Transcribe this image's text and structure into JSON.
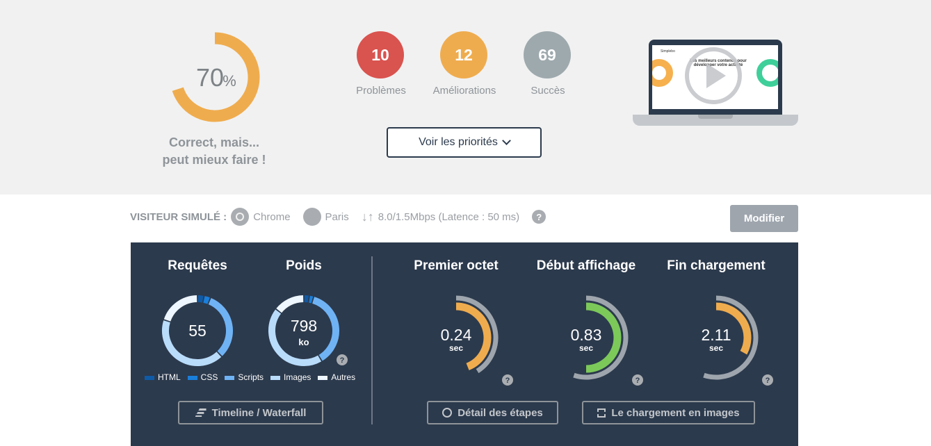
{
  "score": {
    "value": "70",
    "unit": "%",
    "fraction": 0.7,
    "color": "#efac4e",
    "label_line1": "Correct, mais...",
    "label_line2": "peut mieux faire !"
  },
  "counters": [
    {
      "value": "10",
      "label": "Problèmes",
      "color": "#d9534f"
    },
    {
      "value": "12",
      "label": "Améliorations",
      "color": "#efac4e"
    },
    {
      "value": "69",
      "label": "Succès",
      "color": "#9ea9ad"
    }
  ],
  "priorities_button": "Voir les priorités",
  "video": {
    "icon": "play-icon",
    "preview_heading": "Les meilleurs contenus pour développer votre activité",
    "preview_logo": "Simplebo"
  },
  "visitor": {
    "label": "VISITEUR SIMULÉ :",
    "browser": "Chrome",
    "location": "Paris",
    "connection": "8.0/1.5Mbps (Latence : 50 ms)",
    "help": "?",
    "modify_button": "Modifier"
  },
  "requests": {
    "title": "Requêtes",
    "value": "55",
    "segments": [
      0.03,
      0.03,
      0.32,
      0.42,
      0.2
    ]
  },
  "weight": {
    "title": "Poids",
    "value": "798",
    "unit": "ko",
    "help": "?",
    "segments": [
      0.025,
      0.02,
      0.37,
      0.44,
      0.145
    ]
  },
  "legend": [
    {
      "label": "HTML",
      "color": "#0f5ba7"
    },
    {
      "label": "CSS",
      "color": "#1a7fdb"
    },
    {
      "label": "Scripts",
      "color": "#6fb3f5"
    },
    {
      "label": "Images",
      "color": "#b9dcfb"
    },
    {
      "label": "Autres",
      "color": "#eef6ff"
    }
  ],
  "timeline_button": "Timeline / Waterfall",
  "timings": [
    {
      "title": "Premier octet",
      "value": "0.24",
      "unit": "sec",
      "fraction": 0.44,
      "reference": 0.41,
      "color": "#efac4e",
      "help": "?"
    },
    {
      "title": "Début affichage",
      "value": "0.83",
      "unit": "sec",
      "fraction": 0.5,
      "reference": 0.55,
      "color": "#7cc95a",
      "help": "?"
    },
    {
      "title": "Fin chargement",
      "value": "2.11",
      "unit": "sec",
      "fraction": 0.33,
      "reference": 0.55,
      "color": "#efac4e",
      "help": "?"
    }
  ],
  "steps_button": "Détail des étapes",
  "images_button": "Le chargement en images"
}
